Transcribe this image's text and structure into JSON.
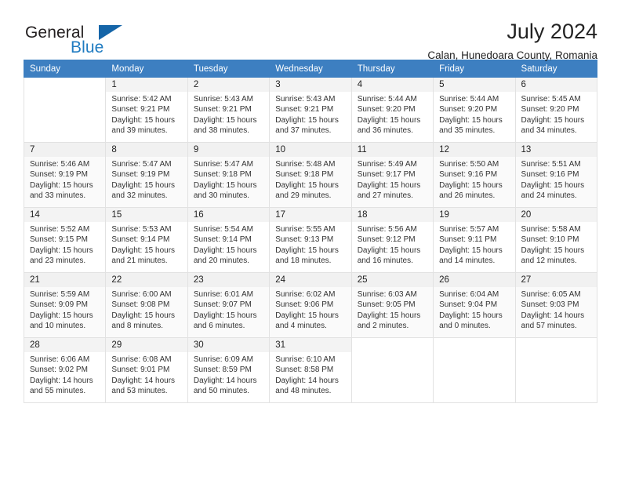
{
  "brand": {
    "word_one": "General",
    "word_two": "Blue",
    "triangle_icon": "triangle-icon",
    "color_blue": "#1f7bc1",
    "color_dark": "#231f20"
  },
  "header": {
    "title": "July 2024",
    "location": "Calan, Hunedoara County, Romania"
  },
  "calendar": {
    "accent_color": "#3d7fc1",
    "weekday_headers": [
      "Sunday",
      "Monday",
      "Tuesday",
      "Wednesday",
      "Thursday",
      "Friday",
      "Saturday"
    ],
    "labels": {
      "sunrise": "Sunrise:",
      "sunset": "Sunset:",
      "daylight": "Daylight:"
    },
    "weeks": [
      [
        {
          "day": "",
          "empty": true
        },
        {
          "day": "1",
          "sunrise": "Sunrise: 5:42 AM",
          "sunset": "Sunset: 9:21 PM",
          "daylight_a": "Daylight: 15 hours",
          "daylight_b": "and 39 minutes."
        },
        {
          "day": "2",
          "sunrise": "Sunrise: 5:43 AM",
          "sunset": "Sunset: 9:21 PM",
          "daylight_a": "Daylight: 15 hours",
          "daylight_b": "and 38 minutes."
        },
        {
          "day": "3",
          "sunrise": "Sunrise: 5:43 AM",
          "sunset": "Sunset: 9:21 PM",
          "daylight_a": "Daylight: 15 hours",
          "daylight_b": "and 37 minutes."
        },
        {
          "day": "4",
          "sunrise": "Sunrise: 5:44 AM",
          "sunset": "Sunset: 9:20 PM",
          "daylight_a": "Daylight: 15 hours",
          "daylight_b": "and 36 minutes."
        },
        {
          "day": "5",
          "sunrise": "Sunrise: 5:44 AM",
          "sunset": "Sunset: 9:20 PM",
          "daylight_a": "Daylight: 15 hours",
          "daylight_b": "and 35 minutes."
        },
        {
          "day": "6",
          "sunrise": "Sunrise: 5:45 AM",
          "sunset": "Sunset: 9:20 PM",
          "daylight_a": "Daylight: 15 hours",
          "daylight_b": "and 34 minutes."
        }
      ],
      [
        {
          "day": "7",
          "sunrise": "Sunrise: 5:46 AM",
          "sunset": "Sunset: 9:19 PM",
          "daylight_a": "Daylight: 15 hours",
          "daylight_b": "and 33 minutes."
        },
        {
          "day": "8",
          "sunrise": "Sunrise: 5:47 AM",
          "sunset": "Sunset: 9:19 PM",
          "daylight_a": "Daylight: 15 hours",
          "daylight_b": "and 32 minutes."
        },
        {
          "day": "9",
          "sunrise": "Sunrise: 5:47 AM",
          "sunset": "Sunset: 9:18 PM",
          "daylight_a": "Daylight: 15 hours",
          "daylight_b": "and 30 minutes."
        },
        {
          "day": "10",
          "sunrise": "Sunrise: 5:48 AM",
          "sunset": "Sunset: 9:18 PM",
          "daylight_a": "Daylight: 15 hours",
          "daylight_b": "and 29 minutes."
        },
        {
          "day": "11",
          "sunrise": "Sunrise: 5:49 AM",
          "sunset": "Sunset: 9:17 PM",
          "daylight_a": "Daylight: 15 hours",
          "daylight_b": "and 27 minutes."
        },
        {
          "day": "12",
          "sunrise": "Sunrise: 5:50 AM",
          "sunset": "Sunset: 9:16 PM",
          "daylight_a": "Daylight: 15 hours",
          "daylight_b": "and 26 minutes."
        },
        {
          "day": "13",
          "sunrise": "Sunrise: 5:51 AM",
          "sunset": "Sunset: 9:16 PM",
          "daylight_a": "Daylight: 15 hours",
          "daylight_b": "and 24 minutes."
        }
      ],
      [
        {
          "day": "14",
          "sunrise": "Sunrise: 5:52 AM",
          "sunset": "Sunset: 9:15 PM",
          "daylight_a": "Daylight: 15 hours",
          "daylight_b": "and 23 minutes."
        },
        {
          "day": "15",
          "sunrise": "Sunrise: 5:53 AM",
          "sunset": "Sunset: 9:14 PM",
          "daylight_a": "Daylight: 15 hours",
          "daylight_b": "and 21 minutes."
        },
        {
          "day": "16",
          "sunrise": "Sunrise: 5:54 AM",
          "sunset": "Sunset: 9:14 PM",
          "daylight_a": "Daylight: 15 hours",
          "daylight_b": "and 20 minutes."
        },
        {
          "day": "17",
          "sunrise": "Sunrise: 5:55 AM",
          "sunset": "Sunset: 9:13 PM",
          "daylight_a": "Daylight: 15 hours",
          "daylight_b": "and 18 minutes."
        },
        {
          "day": "18",
          "sunrise": "Sunrise: 5:56 AM",
          "sunset": "Sunset: 9:12 PM",
          "daylight_a": "Daylight: 15 hours",
          "daylight_b": "and 16 minutes."
        },
        {
          "day": "19",
          "sunrise": "Sunrise: 5:57 AM",
          "sunset": "Sunset: 9:11 PM",
          "daylight_a": "Daylight: 15 hours",
          "daylight_b": "and 14 minutes."
        },
        {
          "day": "20",
          "sunrise": "Sunrise: 5:58 AM",
          "sunset": "Sunset: 9:10 PM",
          "daylight_a": "Daylight: 15 hours",
          "daylight_b": "and 12 minutes."
        }
      ],
      [
        {
          "day": "21",
          "sunrise": "Sunrise: 5:59 AM",
          "sunset": "Sunset: 9:09 PM",
          "daylight_a": "Daylight: 15 hours",
          "daylight_b": "and 10 minutes."
        },
        {
          "day": "22",
          "sunrise": "Sunrise: 6:00 AM",
          "sunset": "Sunset: 9:08 PM",
          "daylight_a": "Daylight: 15 hours",
          "daylight_b": "and 8 minutes."
        },
        {
          "day": "23",
          "sunrise": "Sunrise: 6:01 AM",
          "sunset": "Sunset: 9:07 PM",
          "daylight_a": "Daylight: 15 hours",
          "daylight_b": "and 6 minutes."
        },
        {
          "day": "24",
          "sunrise": "Sunrise: 6:02 AM",
          "sunset": "Sunset: 9:06 PM",
          "daylight_a": "Daylight: 15 hours",
          "daylight_b": "and 4 minutes."
        },
        {
          "day": "25",
          "sunrise": "Sunrise: 6:03 AM",
          "sunset": "Sunset: 9:05 PM",
          "daylight_a": "Daylight: 15 hours",
          "daylight_b": "and 2 minutes."
        },
        {
          "day": "26",
          "sunrise": "Sunrise: 6:04 AM",
          "sunset": "Sunset: 9:04 PM",
          "daylight_a": "Daylight: 15 hours",
          "daylight_b": "and 0 minutes."
        },
        {
          "day": "27",
          "sunrise": "Sunrise: 6:05 AM",
          "sunset": "Sunset: 9:03 PM",
          "daylight_a": "Daylight: 14 hours",
          "daylight_b": "and 57 minutes."
        }
      ],
      [
        {
          "day": "28",
          "sunrise": "Sunrise: 6:06 AM",
          "sunset": "Sunset: 9:02 PM",
          "daylight_a": "Daylight: 14 hours",
          "daylight_b": "and 55 minutes."
        },
        {
          "day": "29",
          "sunrise": "Sunrise: 6:08 AM",
          "sunset": "Sunset: 9:01 PM",
          "daylight_a": "Daylight: 14 hours",
          "daylight_b": "and 53 minutes."
        },
        {
          "day": "30",
          "sunrise": "Sunrise: 6:09 AM",
          "sunset": "Sunset: 8:59 PM",
          "daylight_a": "Daylight: 14 hours",
          "daylight_b": "and 50 minutes."
        },
        {
          "day": "31",
          "sunrise": "Sunrise: 6:10 AM",
          "sunset": "Sunset: 8:58 PM",
          "daylight_a": "Daylight: 14 hours",
          "daylight_b": "and 48 minutes."
        },
        {
          "day": "",
          "empty": true
        },
        {
          "day": "",
          "empty": true
        },
        {
          "day": "",
          "empty": true
        }
      ]
    ]
  }
}
